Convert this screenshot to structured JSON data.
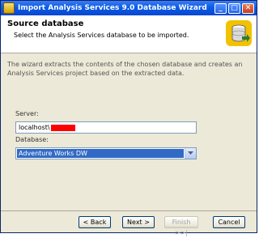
{
  "window": {
    "title": "Import Analysis Services 9.0 Database Wizard",
    "minimize_glyph": "_",
    "maximize_glyph": "□",
    "close_glyph": "✕"
  },
  "header": {
    "heading": "Source database",
    "subheading": "Select the Analysis Services database to be imported.",
    "icon": "database-import-icon"
  },
  "content": {
    "description": "The wizard extracts the contents of the chosen database and creates an Analysis Services project based on the extracted data.",
    "server_label": "Server:",
    "server_value": "localhost\\",
    "database_label": "Database:",
    "database_value": "Adventure Works DW"
  },
  "footer": {
    "back_label": "< Back",
    "next_label": "Next >",
    "finish_label": "Finish >>|",
    "cancel_label": "Cancel"
  },
  "colors": {
    "titlebar": "#0a5ce6",
    "selection": "#316ac5",
    "redaction": "#ff0000"
  }
}
